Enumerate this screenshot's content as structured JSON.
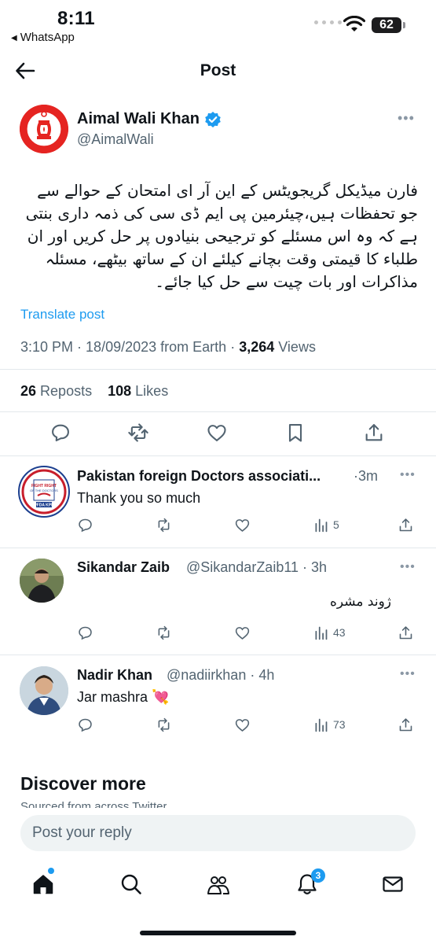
{
  "status_bar": {
    "time": "8:11",
    "back_app": "WhatsApp",
    "battery": "62"
  },
  "header": {
    "title": "Post",
    "back_icon": "arrow-left-icon"
  },
  "post": {
    "author_name": "Aimal Wali Khan",
    "author_handle": "@AimalWali",
    "verified": true,
    "text": "فارن میڈیکل گریجویٹس کے این آر ای امتحان کے حوالے سے جو تحفظات ہیں،چیئرمین پی ایم ڈی سی کی ذمہ داری بنتی ہے کہ وہ اس مسئلے کو ترجیحی بنیادوں پر حل کریں اور ان طلباء کا قیمتی وقت بچانے کیلئے ان کے ساتھ بیٹھے، مسئلہ مذاکرات اور بات چیت سے حل کیا جائے۔",
    "translate_label": "Translate post",
    "time": "3:10 PM",
    "date": "18/09/2023",
    "source": "from Earth",
    "views_count": "3,264",
    "views_label": "Views",
    "reposts_count": "26",
    "reposts_label": "Reposts",
    "likes_count": "108",
    "likes_label": "Likes"
  },
  "replies": [
    {
      "name": "Pakistan foreign Doctors associati...",
      "handle": "",
      "time": "3m",
      "text": "Thank you so much",
      "views": "5",
      "avatar_text": "PFDA KPK"
    },
    {
      "name": "Sikandar Zaib",
      "handle": "@SikandarZaib11",
      "time": "3h",
      "text": "ژوند مشره",
      "views": "43"
    },
    {
      "name": "Nadir Khan",
      "handle": "@nadiirkhan",
      "time": "4h",
      "text": "Jar mashra 💘",
      "views": "73"
    }
  ],
  "discover": {
    "title": "Discover more",
    "subtitle": "Sourced from across Twitter"
  },
  "reply_box": {
    "placeholder": "Post your reply"
  },
  "tab_bar": {
    "notifications_badge": "3",
    "icons": [
      "home-icon",
      "search-icon",
      "communities-icon",
      "notifications-icon",
      "messages-icon"
    ]
  },
  "colors": {
    "accent": "#1d9bf0",
    "text": "#0f1419",
    "secondary": "#536471",
    "divider": "#e3e8ec",
    "brand_red": "#e52421"
  }
}
